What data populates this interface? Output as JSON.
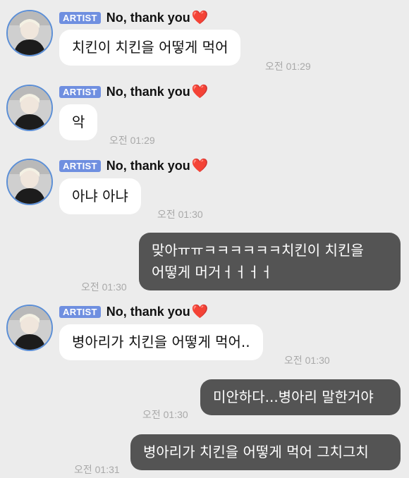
{
  "sender": {
    "badge": "ARTIST",
    "name": "No, thank you",
    "heart": "❤️"
  },
  "messages": [
    {
      "direction": "in",
      "text": "치킨이 치킨을 어떻게 먹어",
      "time": "오전 01:29"
    },
    {
      "direction": "in",
      "text": "악",
      "time": "오전 01:29"
    },
    {
      "direction": "in",
      "text": "아냐 아냐",
      "time": "오전 01:30"
    },
    {
      "direction": "out",
      "lines": [
        "맞아ㅠㅠㅋㅋㅋㅋㅋㅋ치킨이 치킨을",
        "어떻게 머거ㅓㅓㅓㅓ"
      ],
      "time": "오전 01:30"
    },
    {
      "direction": "in",
      "text": "병아리가 치킨을 어떻게 먹어..",
      "time": "오전 01:30"
    },
    {
      "direction": "out",
      "text": "미안하다...병아리 말한거야",
      "time": "오전 01:30"
    },
    {
      "direction": "out",
      "text": "병아리가 치킨을 어떻게 먹어 그치그치",
      "time": "오전 01:31"
    }
  ],
  "colors": {
    "background": "#ececec",
    "incoming_bubble": "#ffffff",
    "outgoing_bubble": "#545454",
    "badge": "#6f8fe0",
    "heart": "#e0262b"
  }
}
